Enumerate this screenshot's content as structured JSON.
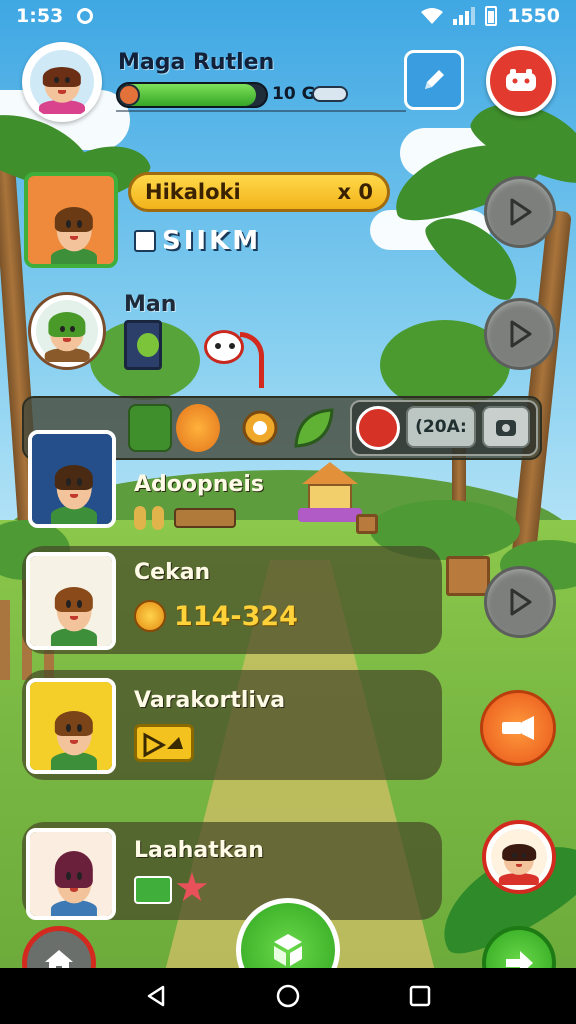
{
  "status_bar": {
    "time": "1:53",
    "right_text": "1550"
  },
  "player": {
    "name": "Maga Rutlen",
    "xp_value": "10 GI",
    "xp_progress": 0.93
  },
  "rows": [
    {
      "pill_label": "Hikaloki",
      "pill_count": "x 0",
      "code": "SIIKM"
    },
    {
      "title": "Man"
    },
    {
      "title": "Adoopneis"
    },
    {
      "title": "Cekan",
      "gold": "114-324"
    },
    {
      "title": "Varakortliva"
    },
    {
      "title": "Laahatkan"
    }
  ],
  "toolbar": {
    "chip_label": "(20A:"
  },
  "icons": {
    "status_sync": "sync-icon",
    "wifi": "wifi-icon",
    "signal": "signal-icon",
    "battery": "battery-icon",
    "edit": "pencil-icon",
    "menu_red": "game-controller-icon",
    "play": "play-icon",
    "home": "home-icon",
    "center": "cube-icon",
    "go": "arrow-right-icon",
    "back": "back-icon",
    "home_nav": "circle-home-icon",
    "recents": "square-recents-icon"
  },
  "colors": {
    "accent_yellow": "#f2b31a",
    "accent_red": "#e23a2e",
    "accent_green": "#34a626",
    "panel": "#464a28",
    "gold_text": "#ffd23a"
  }
}
